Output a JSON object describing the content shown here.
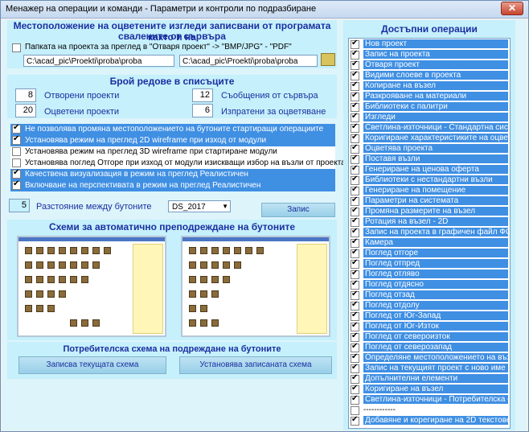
{
  "window": {
    "title": "Менажер на операции и команди - Параметри и контроли по подразбиране",
    "close_label": "✕"
  },
  "location": {
    "heading": "Местоположение на оцветените изгледи записвани от програмата както и на сваленитe от сървъра",
    "heading_line1": "Местоположение на оцветените изгледи записвани от програмата както и на",
    "heading_line2": "свалените от сървъра",
    "folder_label": "Папката на проекта за преглед в \"Отваря проект\" -> \"BMP/JPG\" - \"PDF\"",
    "folder_checked": false,
    "path_left": "C:\\acad_pic\\Proekti\\proba\\proba",
    "path_right": "C:\\acad_pic\\Proekti\\proba\\proba"
  },
  "rows": {
    "heading": "Брой редове в списъците",
    "open_projects_value": "8",
    "open_projects_label": "Отворени проекти",
    "colored_projects_value": "20",
    "colored_projects_label": "Оцветени проекти",
    "server_messages_value": "12",
    "server_messages_label": "Съобщения от сървъра",
    "sent_for_coloring_value": "6",
    "sent_for_coloring_label": "Изпратени за оцветяване"
  },
  "options": [
    {
      "label": "Не позволява промяна местоположението на бутоните стартиращи операциите",
      "checked": true,
      "selected": true
    },
    {
      "label": "Установява режим на преглед 2D wireframe при изход от модули",
      "checked": true,
      "selected": true
    },
    {
      "label": "Установява режим на преглед 3D wireframe при стартиране модули",
      "checked": false,
      "selected": false
    },
    {
      "label": "Установява поглед Отгоре при изход от модули изискващи избор на възли от проекта",
      "checked": false,
      "selected": false
    },
    {
      "label": "Качествена визуализация в режим на преглед Реалистичен",
      "checked": true,
      "selected": true
    },
    {
      "label": "Включване на перспективата в режим на преглед Реалистичен",
      "checked": true,
      "selected": true
    }
  ],
  "spacing": {
    "value": "5",
    "label": "Разстояние между бутоните",
    "combo_value": "DS_2017",
    "save_label": "Запис"
  },
  "schemes": {
    "heading": "Схеми за автоматично преподреждане на бутоните",
    "user_heading": "Потребителска схема на подреждане на бутоните",
    "save_current_label": "Записва текущата схема",
    "apply_saved_label": "Установява записаната схема"
  },
  "operations": {
    "heading": "Достъпни операции",
    "items": [
      {
        "label": "Нов проект",
        "checked": true,
        "selected": true
      },
      {
        "label": "Запис на проекта",
        "checked": true,
        "selected": true
      },
      {
        "label": "Отваря проект",
        "checked": true,
        "selected": true
      },
      {
        "label": "Видими слоеве в проекта",
        "checked": true,
        "selected": true
      },
      {
        "label": "Копиране на възел",
        "checked": true,
        "selected": true
      },
      {
        "label": "Разкрояване на материали",
        "checked": true,
        "selected": true
      },
      {
        "label": "Библиотеки с палитри",
        "checked": true,
        "selected": true
      },
      {
        "label": "Изгледи",
        "checked": true,
        "selected": true
      },
      {
        "label": "Светлина-източници - Стандартна система",
        "checked": true,
        "selected": true
      },
      {
        "label": "Коригиране характеристиките на оцветяващи",
        "checked": true,
        "selected": true
      },
      {
        "label": "Оцветява проекта",
        "checked": true,
        "selected": true
      },
      {
        "label": "Поставя възли",
        "checked": true,
        "selected": true
      },
      {
        "label": "Генериране на ценова оферта",
        "checked": true,
        "selected": true
      },
      {
        "label": "Библиотеки с нестандартни възли",
        "checked": true,
        "selected": true
      },
      {
        "label": "Генериране на помещение",
        "checked": true,
        "selected": true
      },
      {
        "label": "Параметри на системата",
        "checked": true,
        "selected": true
      },
      {
        "label": "Промяна размерите на възел",
        "checked": true,
        "selected": true
      },
      {
        "label": "Ротация на възел - 2D",
        "checked": true,
        "selected": true
      },
      {
        "label": "Запис на проекта в графичен файл ФОРМА",
        "checked": true,
        "selected": true
      },
      {
        "label": "Камера",
        "checked": true,
        "selected": true
      },
      {
        "label": "Поглед отгоре",
        "checked": true,
        "selected": true
      },
      {
        "label": "Поглед отпред",
        "checked": true,
        "selected": true
      },
      {
        "label": "Поглед отляво",
        "checked": true,
        "selected": true
      },
      {
        "label": "Поглед отдясно",
        "checked": true,
        "selected": true
      },
      {
        "label": "Поглед отзад",
        "checked": true,
        "selected": true
      },
      {
        "label": "Поглед отдолу",
        "checked": true,
        "selected": true
      },
      {
        "label": "Поглед от Юг-Запад",
        "checked": true,
        "selected": true
      },
      {
        "label": "Поглед от Юг-Изток",
        "checked": true,
        "selected": true
      },
      {
        "label": "Поглед от североизток",
        "checked": true,
        "selected": true
      },
      {
        "label": "Поглед от северозапад",
        "checked": true,
        "selected": true
      },
      {
        "label": "Определяне местоположението на възел",
        "checked": true,
        "selected": true
      },
      {
        "label": "Запис на текущият проект с ново име",
        "checked": true,
        "selected": true
      },
      {
        "label": "Допълнителни елементи",
        "checked": true,
        "selected": true
      },
      {
        "label": "Коригиране на възел",
        "checked": true,
        "selected": true
      },
      {
        "label": "Светлина-източници - Потребителска система",
        "checked": true,
        "selected": true
      },
      {
        "label": "------------",
        "checked": false,
        "selected": false
      },
      {
        "label": "Добавяне и корегиране на 2D текстове в прое",
        "checked": true,
        "selected": true
      }
    ]
  }
}
